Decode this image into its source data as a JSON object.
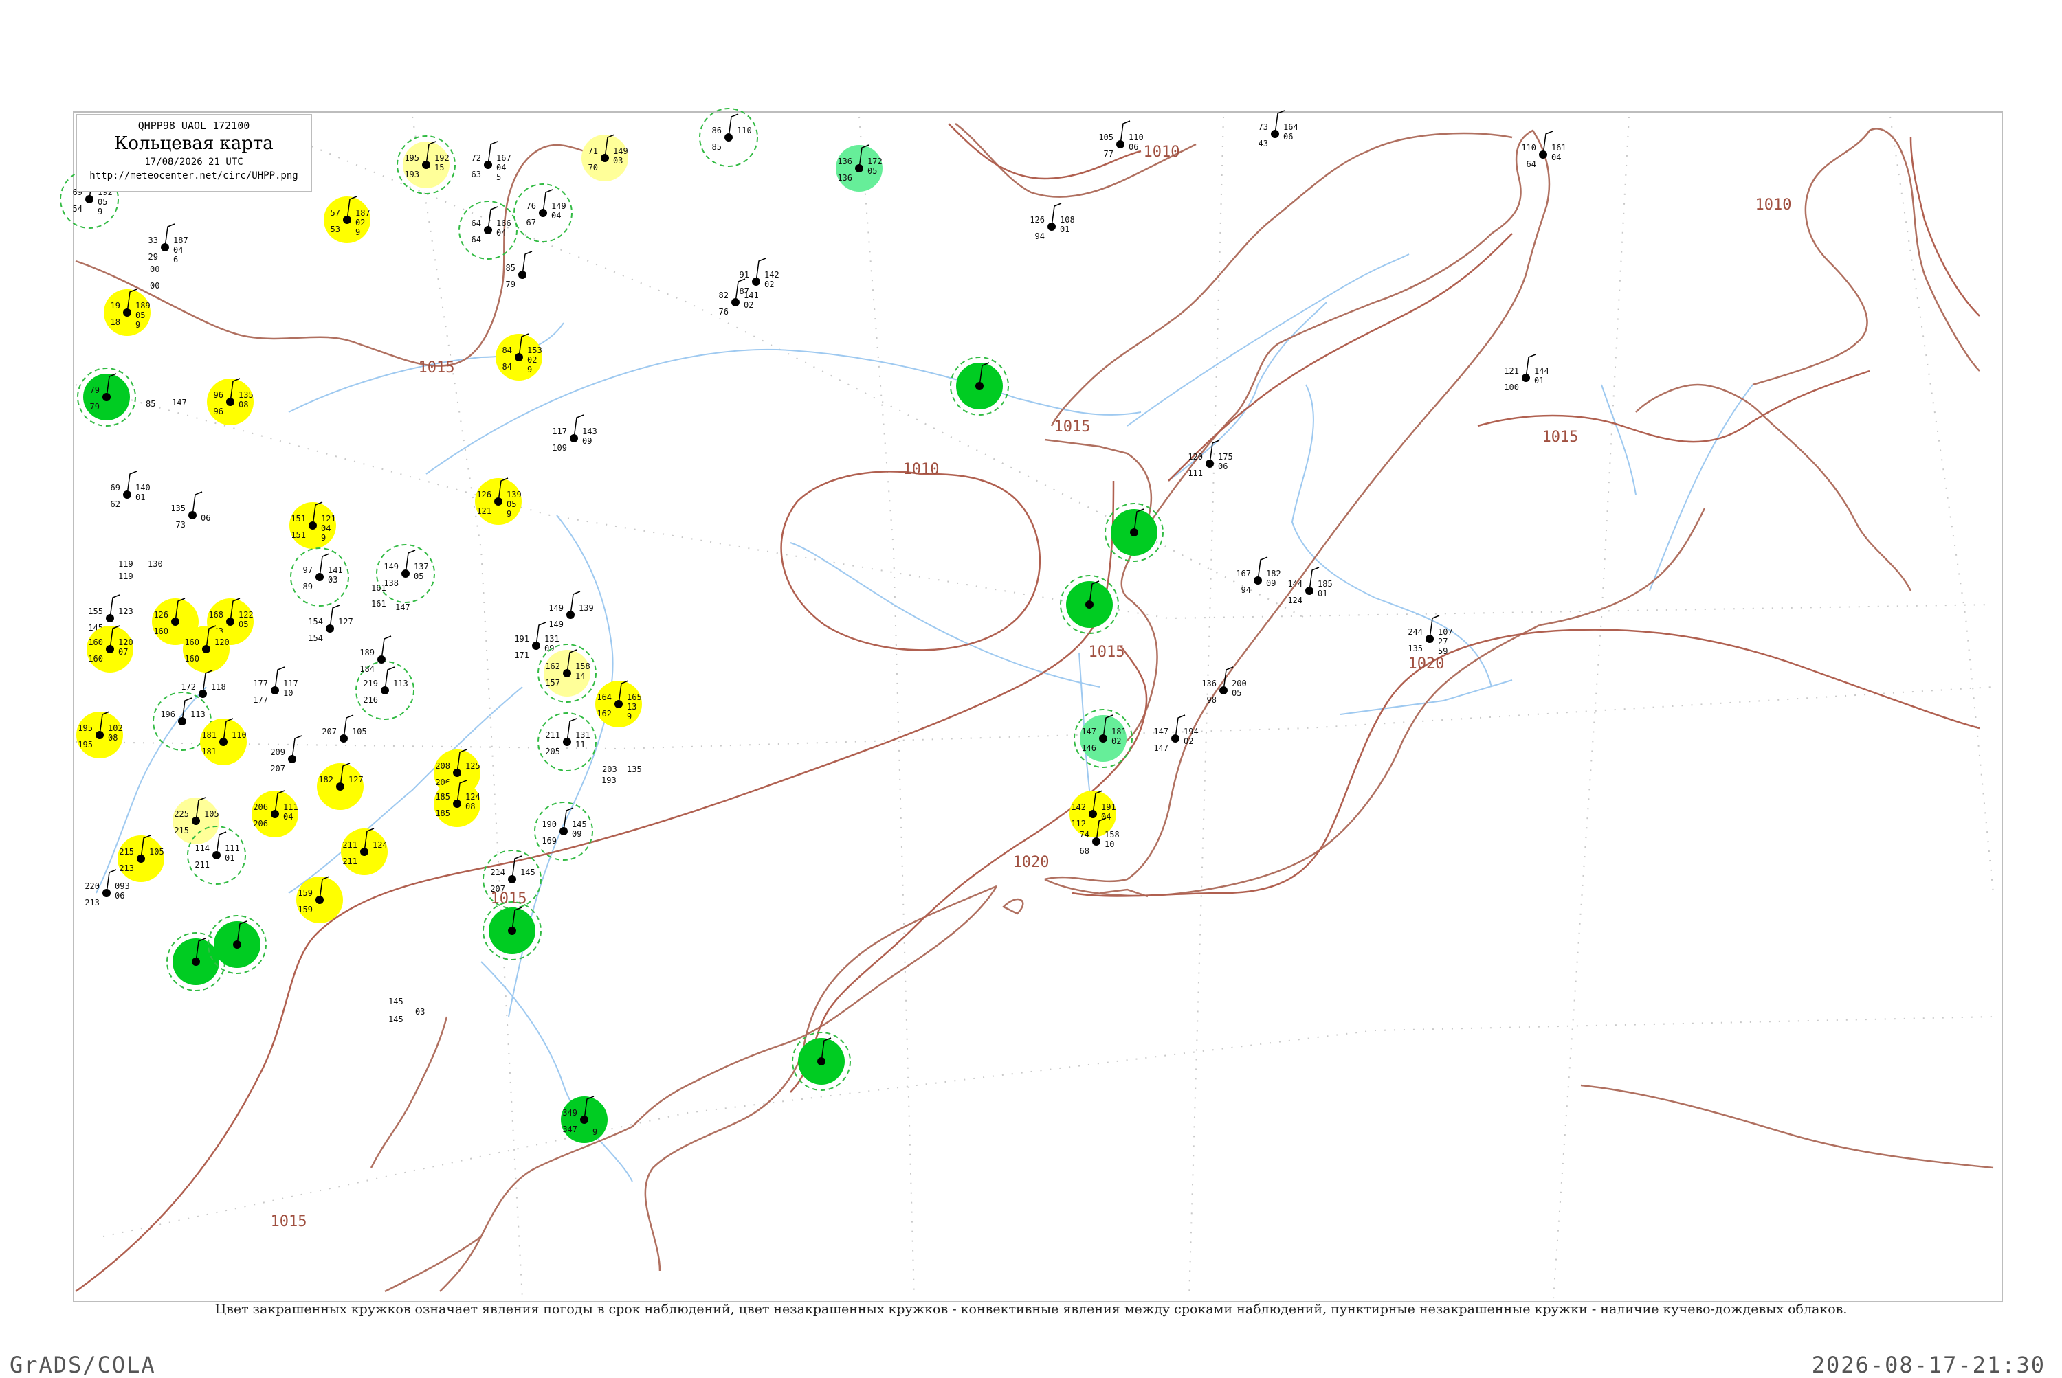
{
  "header": {
    "code": "QHPP98  UAOL  172100",
    "title": "Кольцевая карта",
    "date": "17/08/2026 21 UTC",
    "url": "http://meteocenter.net/circ/UHPP.png"
  },
  "footnote": "Цвет закрашенных кружков означает явления погоды в срок наблюдений, цвет незакрашенных кружков - конвективные явления между сроками наблюдений, пунктирные незакрашенные кружки - наличие кучево-дождевых облаков.",
  "footer": {
    "left": "GrADS/COLA",
    "right": "2026-08-17-21:30"
  },
  "colors": {
    "frame": "#bdbdbd",
    "coast": "#b07060",
    "rivers": "#9ec9f0",
    "isobar": "#b06050",
    "isobar_label": "#a05040",
    "yellow": "#ffff00",
    "pale_yellow": "#ffff99",
    "green": "#00cc22",
    "light_green": "#66ee99",
    "ring": "#33bb44"
  },
  "isobars": [
    {
      "label": "1010"
    },
    {
      "label": "1010"
    },
    {
      "label": "1010"
    },
    {
      "label": "1015"
    },
    {
      "label": "1015"
    },
    {
      "label": "1015"
    },
    {
      "label": "1015"
    },
    {
      "label": "1015"
    },
    {
      "label": "1015"
    },
    {
      "label": "1020"
    },
    {
      "label": "1020"
    }
  ],
  "stations": [
    {
      "t": "69",
      "td": "54",
      "p": "192",
      "dp": "05",
      "s": "9",
      "fill": "none",
      "ring": "dash"
    },
    {
      "t": "33",
      "td": "29",
      "p": "187",
      "dp": "04",
      "s": "6",
      "fill": "none",
      "ring": "none"
    },
    {
      "t": "19",
      "td": "18",
      "p": "189",
      "dp": "05",
      "s": "9",
      "fill": "yellow",
      "ring": "none"
    },
    {
      "t": "79",
      "td": "79",
      "p": "",
      "dp": "",
      "s": "",
      "fill": "green",
      "ring": "dash"
    },
    {
      "t": "96",
      "td": "96",
      "p": "135",
      "dp": "08",
      "s": "",
      "fill": "yellow",
      "ring": "none"
    },
    {
      "t": "57",
      "td": "53",
      "p": "187",
      "dp": "02",
      "s": "9",
      "fill": "yellow",
      "ring": "none"
    },
    {
      "t": "72",
      "td": "63",
      "p": "167",
      "dp": "04",
      "s": "5",
      "fill": "none",
      "ring": "none"
    },
    {
      "t": "64",
      "td": "64",
      "p": "166",
      "dp": "04",
      "s": "",
      "fill": "none",
      "ring": "dash"
    },
    {
      "t": "76",
      "td": "67",
      "p": "149",
      "dp": "04",
      "s": "",
      "fill": "none",
      "ring": "dash"
    },
    {
      "t": "71",
      "td": "70",
      "p": "149",
      "dp": "03",
      "s": "",
      "fill": "pale_yellow",
      "ring": "none"
    },
    {
      "t": "86",
      "td": "85",
      "p": "110",
      "dp": "",
      "s": "",
      "fill": "none",
      "ring": "dash"
    },
    {
      "t": "85",
      "td": "79",
      "p": "",
      "dp": "",
      "s": "",
      "fill": "none",
      "ring": "none"
    },
    {
      "t": "84",
      "td": "84",
      "p": "153",
      "dp": "02",
      "s": "9",
      "fill": "yellow",
      "ring": "none"
    },
    {
      "t": "91",
      "td": "87",
      "p": "142",
      "dp": "02",
      "s": "",
      "fill": "none",
      "ring": "none"
    },
    {
      "t": "82",
      "td": "76",
      "p": "141",
      "dp": "02",
      "s": "",
      "fill": "none",
      "ring": "none"
    },
    {
      "t": "105",
      "td": "77",
      "p": "110",
      "dp": "06",
      "s": "",
      "fill": "none",
      "ring": "none"
    },
    {
      "t": "126",
      "td": "94",
      "p": "108",
      "dp": "01",
      "s": "",
      "fill": "none",
      "ring": "none"
    },
    {
      "t": "73",
      "td": "43",
      "p": "164",
      "dp": "06",
      "s": "",
      "fill": "none",
      "ring": "none"
    },
    {
      "t": "110",
      "td": "64",
      "p": "161",
      "dp": "04",
      "s": "",
      "fill": "none",
      "ring": "none"
    },
    {
      "t": "121",
      "td": "100",
      "p": "144",
      "dp": "01",
      "s": "",
      "fill": "none",
      "ring": "none"
    },
    {
      "t": "117",
      "td": "109",
      "p": "143",
      "dp": "09",
      "s": "",
      "fill": "none",
      "ring": "none"
    },
    {
      "t": "69",
      "td": "62",
      "p": "140",
      "dp": "01",
      "s": "",
      "fill": "none",
      "ring": "none"
    },
    {
      "t": "135",
      "td": "73",
      "p": "",
      "dp": "06",
      "s": "",
      "fill": "none",
      "ring": "none"
    },
    {
      "t": "126",
      "td": "121",
      "p": "139",
      "dp": "05",
      "s": "9",
      "fill": "yellow",
      "ring": "none"
    },
    {
      "t": "151",
      "td": "151",
      "p": "121",
      "dp": "04",
      "s": "9",
      "fill": "yellow",
      "ring": "none"
    },
    {
      "t": "97",
      "td": "89",
      "p": "141",
      "dp": "03",
      "s": "",
      "fill": "none",
      "ring": "dash"
    },
    {
      "t": "149",
      "td": "138",
      "p": "137",
      "dp": "05",
      "s": "",
      "fill": "none",
      "ring": "dash"
    },
    {
      "t": "155",
      "td": "145",
      "p": "123",
      "dp": "",
      "s": "",
      "fill": "none",
      "ring": "none"
    },
    {
      "t": "160",
      "td": "160",
      "p": "120",
      "dp": "07",
      "s": "",
      "fill": "yellow",
      "ring": "none"
    },
    {
      "t": "126",
      "td": "160",
      "p": "",
      "dp": "",
      "s": "",
      "fill": "yellow",
      "ring": "none"
    },
    {
      "t": "168",
      "td": "163",
      "p": "122",
      "dp": "05",
      "s": "",
      "fill": "yellow",
      "ring": "none"
    },
    {
      "t": "160",
      "td": "160",
      "p": "120",
      "dp": "",
      "s": "",
      "fill": "yellow",
      "ring": "none"
    },
    {
      "t": "154",
      "td": "154",
      "p": "127",
      "dp": "",
      "s": "",
      "fill": "none",
      "ring": "none"
    },
    {
      "t": "149",
      "td": "149",
      "p": "139",
      "dp": "",
      "s": "",
      "fill": "none",
      "ring": "none"
    },
    {
      "t": "191",
      "td": "171",
      "p": "131",
      "dp": "09",
      "s": "",
      "fill": "none",
      "ring": "none"
    },
    {
      "t": "162",
      "td": "157",
      "p": "158",
      "dp": "14",
      "s": "",
      "fill": "pale_yellow",
      "ring": "dash"
    },
    {
      "t": "164",
      "td": "162",
      "p": "165",
      "dp": "13",
      "s": "9",
      "fill": "yellow",
      "ring": "none"
    },
    {
      "t": "177",
      "td": "177",
      "p": "117",
      "dp": "10",
      "s": "",
      "fill": "none",
      "ring": "none"
    },
    {
      "t": "172",
      "td": "",
      "p": "118",
      "dp": "",
      "s": "",
      "fill": "none",
      "ring": "none"
    },
    {
      "t": "196",
      "td": "",
      "p": "113",
      "dp": "",
      "s": "",
      "fill": "none",
      "ring": "dash"
    },
    {
      "t": "181",
      "td": "181",
      "p": "110",
      "dp": "",
      "s": "",
      "fill": "yellow",
      "ring": "none"
    },
    {
      "t": "195",
      "td": "195",
      "p": "102",
      "dp": "08",
      "s": "",
      "fill": "yellow",
      "ring": "none"
    },
    {
      "t": "219",
      "td": "216",
      "p": "113",
      "dp": "",
      "s": "",
      "fill": "none",
      "ring": "dash"
    },
    {
      "t": "189",
      "td": "184",
      "p": "",
      "dp": "",
      "s": "",
      "fill": "none",
      "ring": "none"
    },
    {
      "t": "207",
      "td": "",
      "p": "105",
      "dp": "",
      "s": "",
      "fill": "none",
      "ring": "none"
    },
    {
      "t": "209",
      "td": "207",
      "p": "",
      "dp": "",
      "s": "",
      "fill": "none",
      "ring": "none"
    },
    {
      "t": "211",
      "td": "205",
      "p": "131",
      "dp": "11",
      "s": "",
      "fill": "none",
      "ring": "dash"
    },
    {
      "t": "208",
      "td": "206",
      "p": "125",
      "dp": "",
      "s": "",
      "fill": "yellow",
      "ring": "none"
    },
    {
      "t": "185",
      "td": "185",
      "p": "124",
      "dp": "08",
      "s": "",
      "fill": "yellow",
      "ring": "none"
    },
    {
      "t": "182",
      "td": "",
      "p": "127",
      "dp": "",
      "s": "",
      "fill": "yellow",
      "ring": "none"
    },
    {
      "t": "206",
      "td": "206",
      "p": "111",
      "dp": "04",
      "s": "",
      "fill": "yellow",
      "ring": "none"
    },
    {
      "t": "225",
      "td": "215",
      "p": "105",
      "dp": "",
      "s": "",
      "fill": "pale_yellow",
      "ring": "none"
    },
    {
      "t": "114",
      "td": "211",
      "p": "111",
      "dp": "01",
      "s": "",
      "fill": "none",
      "ring": "dash"
    },
    {
      "t": "215",
      "td": "213",
      "p": "105",
      "dp": "",
      "s": "",
      "fill": "yellow",
      "ring": "none"
    },
    {
      "t": "220",
      "td": "213",
      "p": "093",
      "dp": "06",
      "s": "",
      "fill": "none",
      "ring": "none"
    },
    {
      "t": "211",
      "td": "211",
      "p": "124",
      "dp": "",
      "s": "",
      "fill": "yellow",
      "ring": "none"
    },
    {
      "t": "159",
      "td": "159",
      "p": "",
      "dp": "",
      "s": "",
      "fill": "yellow",
      "ring": "none"
    },
    {
      "t": "190",
      "td": "169",
      "p": "145",
      "dp": "09",
      "s": "",
      "fill": "none",
      "ring": "dash"
    },
    {
      "t": "214",
      "td": "207",
      "p": "145",
      "dp": "",
      "s": "",
      "fill": "none",
      "ring": "dash"
    },
    {
      "t": "",
      "td": "",
      "p": "",
      "dp": "",
      "s": "",
      "fill": "green",
      "ring": "dash"
    },
    {
      "t": "",
      "td": "",
      "p": "",
      "dp": "",
      "s": "",
      "fill": "green",
      "ring": "dash"
    },
    {
      "t": "",
      "td": "",
      "p": "",
      "dp": "",
      "s": "",
      "fill": "green",
      "ring": "dash"
    },
    {
      "t": "195",
      "td": "193",
      "p": "192",
      "dp": "15",
      "s": "",
      "fill": "pale_yellow",
      "ring": "dash"
    },
    {
      "t": "349",
      "td": "347",
      "p": "",
      "dp": "",
      "s": "9",
      "fill": "green",
      "ring": "none"
    },
    {
      "t": "",
      "td": "",
      "p": "",
      "dp": "",
      "s": "",
      "fill": "green",
      "ring": "dash"
    },
    {
      "t": "",
      "td": "",
      "p": "",
      "dp": "",
      "s": "",
      "fill": "green",
      "ring": "dash"
    },
    {
      "t": "",
      "td": "",
      "p": "",
      "dp": "",
      "s": "",
      "fill": "green",
      "ring": "dash"
    },
    {
      "t": "",
      "td": "",
      "p": "",
      "dp": "",
      "s": "",
      "fill": "green",
      "ring": "dash"
    },
    {
      "t": "136",
      "td": "136",
      "p": "172",
      "dp": "05",
      "s": "",
      "fill": "light_green",
      "ring": "none"
    },
    {
      "t": "147",
      "td": "146",
      "p": "181",
      "dp": "02",
      "s": "",
      "fill": "light_green",
      "ring": "dash"
    },
    {
      "t": "147",
      "td": "147",
      "p": "194",
      "dp": "02",
      "s": "",
      "fill": "none",
      "ring": "none"
    },
    {
      "t": "142",
      "td": "112",
      "p": "191",
      "dp": "04",
      "s": "",
      "fill": "yellow",
      "ring": "none"
    },
    {
      "t": "74",
      "td": "68",
      "p": "158",
      "dp": "10",
      "s": "",
      "fill": "none",
      "ring": "none"
    },
    {
      "t": "120",
      "td": "111",
      "p": "175",
      "dp": "06",
      "s": "",
      "fill": "none",
      "ring": "none"
    },
    {
      "t": "167",
      "td": "94",
      "p": "182",
      "dp": "09",
      "s": "",
      "fill": "none",
      "ring": "none"
    },
    {
      "t": "144",
      "td": "124",
      "p": "185",
      "dp": "01",
      "s": "",
      "fill": "none",
      "ring": "none"
    },
    {
      "t": "136",
      "td": "98",
      "p": "200",
      "dp": "05",
      "s": "",
      "fill": "none",
      "ring": "none"
    },
    {
      "t": "244",
      "td": "135",
      "p": "107",
      "dp": "27",
      "s": "59",
      "fill": "none",
      "ring": "none"
    }
  ],
  "loose_labels": [
    {
      "text": "85"
    },
    {
      "text": "147"
    },
    {
      "text": "119"
    },
    {
      "text": "130"
    },
    {
      "text": "119"
    },
    {
      "text": "161"
    },
    {
      "text": "161"
    },
    {
      "text": "147"
    },
    {
      "text": "203"
    },
    {
      "text": "135"
    },
    {
      "text": "193"
    },
    {
      "text": "145"
    },
    {
      "text": "145"
    },
    {
      "text": "03"
    },
    {
      "text": "00"
    },
    {
      "text": "00"
    }
  ]
}
